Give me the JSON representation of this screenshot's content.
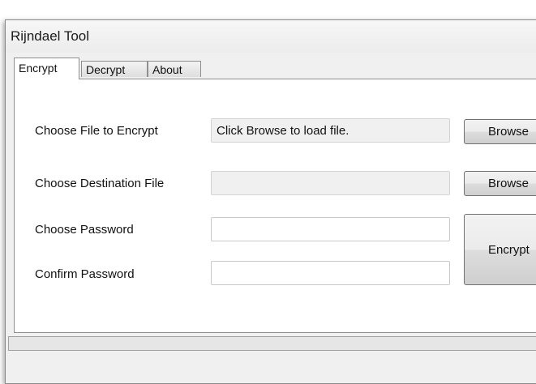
{
  "window": {
    "title": "Rijndael Tool"
  },
  "tabs": [
    {
      "label": "Encrypt",
      "active": true
    },
    {
      "label": "Decrypt",
      "active": false
    },
    {
      "label": "About",
      "active": false
    }
  ],
  "encrypt": {
    "source_label": "Choose File to Encrypt",
    "source_value": "Click Browse to load file.",
    "destination_label": "Choose Destination File",
    "destination_value": "",
    "browse_label": "Browse",
    "password_label": "Choose Password",
    "password_value": "",
    "confirm_label": "Confirm Password",
    "confirm_value": "",
    "encrypt_button": "Encrypt"
  },
  "status": {
    "text": ""
  }
}
